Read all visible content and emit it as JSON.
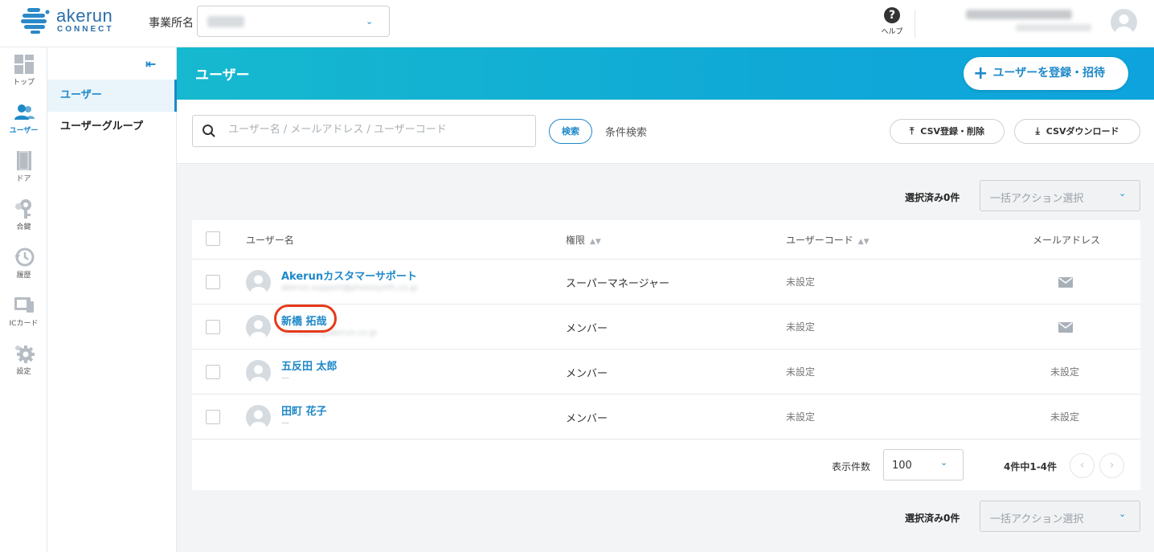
{
  "header": {
    "logo_word": "akerun",
    "logo_sub": "CONNECT",
    "office_label": "事業所名",
    "help_label": "ヘルプ"
  },
  "leftnav": [
    {
      "label": "トップ",
      "icon": "dashboard-icon"
    },
    {
      "label": "ユーザー",
      "icon": "users-icon"
    },
    {
      "label": "ドア",
      "icon": "door-icon"
    },
    {
      "label": "合鍵",
      "icon": "key-icon"
    },
    {
      "label": "履歴",
      "icon": "history-icon"
    },
    {
      "label": "ICカード",
      "icon": "ic-card-icon"
    },
    {
      "label": "設定",
      "icon": "gear-icon"
    }
  ],
  "subnav": {
    "items": [
      {
        "label": "ユーザー",
        "active": true
      },
      {
        "label": "ユーザーグループ",
        "active": false
      }
    ]
  },
  "banner": {
    "title": "ユーザー",
    "invite_label": "ユーザーを登録・招待"
  },
  "search": {
    "placeholder": "ユーザー名 / メールアドレス / ユーザーコード",
    "search_button": "検索",
    "advanced": "条件検索",
    "csv_register": "CSV登録・削除",
    "csv_download": "CSVダウンロード"
  },
  "bulk": {
    "selected_label": "選択済み0件",
    "action_placeholder": "一括アクション選択"
  },
  "table": {
    "headers": {
      "name": "ユーザー名",
      "role": "権限",
      "code": "ユーザーコード",
      "email": "メールアドレス"
    },
    "rows": [
      {
        "name": "Akerunカスタマーサポート",
        "sub": "akerun.support@photosynth.co.jp",
        "role": "スーパーマネージャー",
        "code": "未設定",
        "email": "",
        "has_mail": true
      },
      {
        "name": "新橋 拓哉",
        "sub": "shinbashi@akerun.co.jp",
        "role": "メンバー",
        "code": "未設定",
        "email": "",
        "has_mail": true
      },
      {
        "name": "五反田 太郎",
        "sub": "—",
        "role": "メンバー",
        "code": "未設定",
        "email": "未設定",
        "has_mail": false
      },
      {
        "name": "田町 花子",
        "sub": "—",
        "role": "メンバー",
        "code": "未設定",
        "email": "未設定",
        "has_mail": false
      }
    ]
  },
  "pagination": {
    "per_page_label": "表示件数",
    "per_page_value": "100",
    "count_text": "4件中1-4件"
  },
  "colors": {
    "accent": "#1e88c9",
    "banner_start": "#16b9cf",
    "banner_end": "#0ea3dd",
    "highlight": "#e63a1a"
  }
}
